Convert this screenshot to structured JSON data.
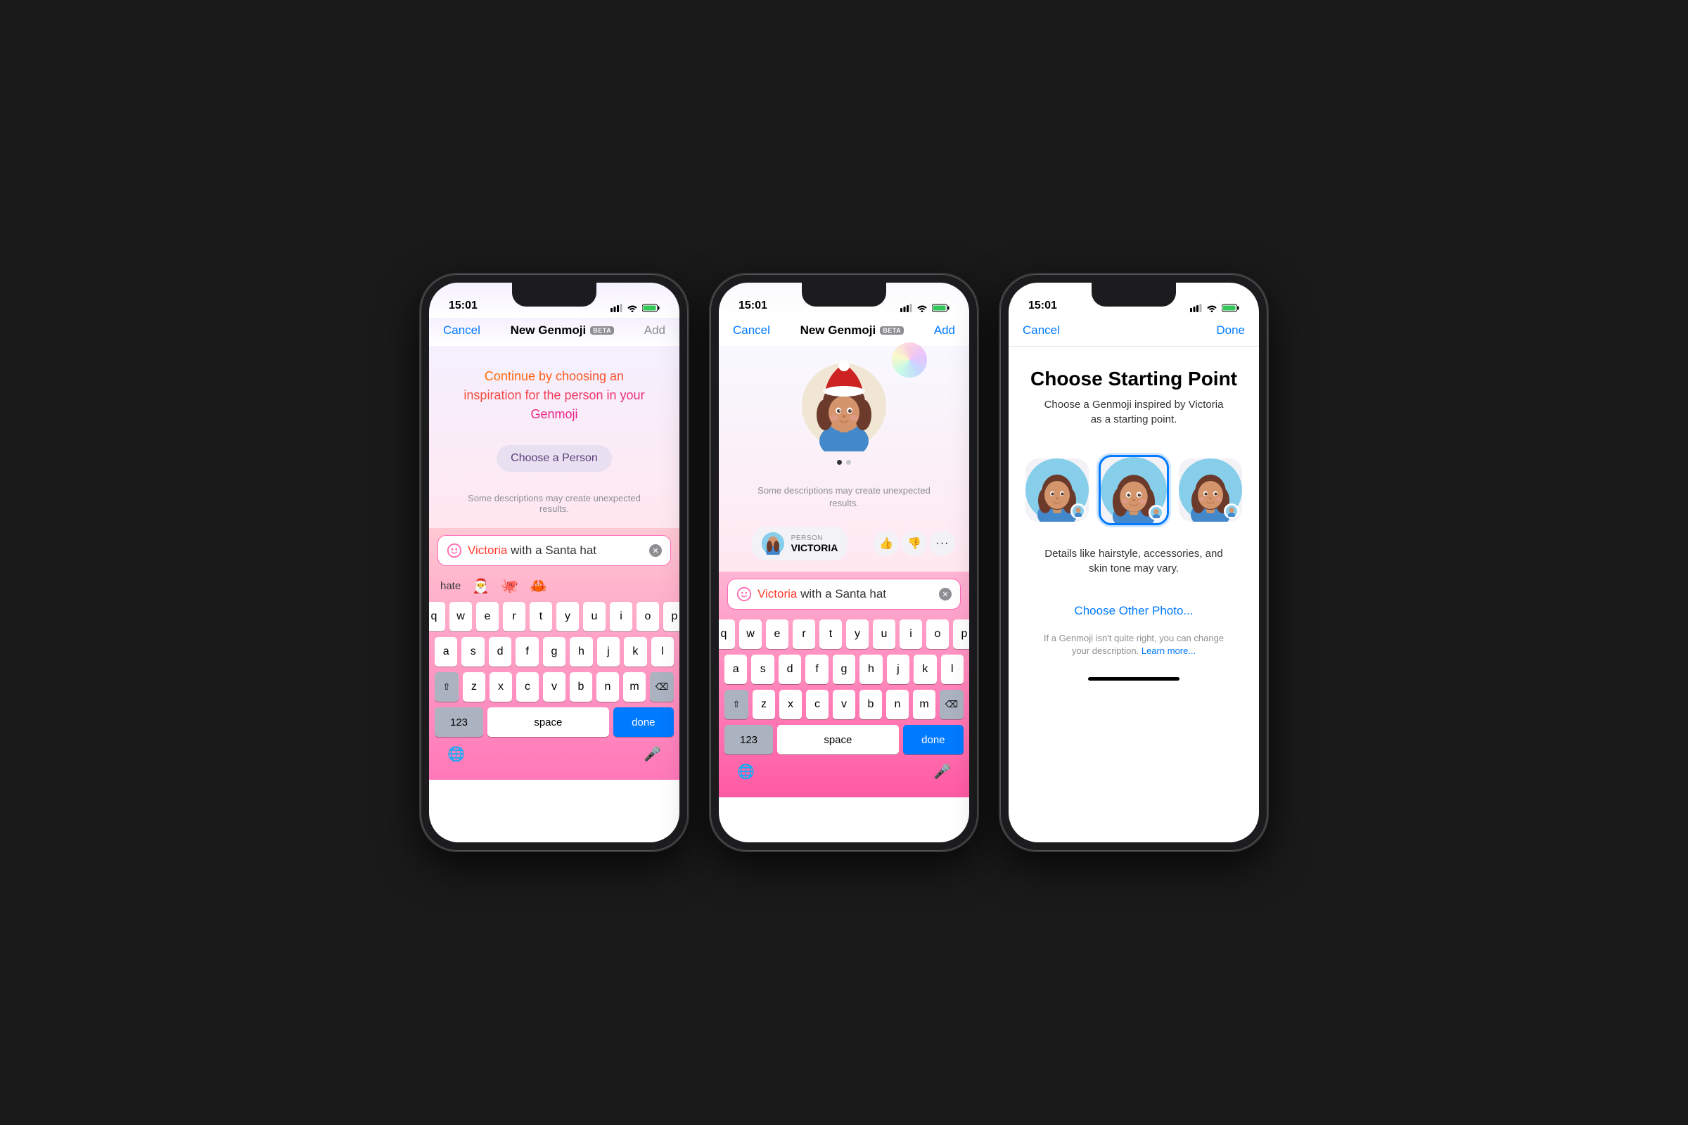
{
  "phone1": {
    "status_time": "15:01",
    "nav_cancel": "Cancel",
    "nav_title": "New Genmoji",
    "beta_label": "BETA",
    "nav_add": "Add",
    "inspiration_text_part1": "Continue by choosing an inspiration for the person in your Genmoji",
    "choose_person_btn": "Choose a Person",
    "unexpected_results": "Some descriptions may create unexpected results.",
    "input_text_highlight": "Victoria",
    "input_text_rest": " with a Santa hat",
    "autocomplete_word": "hate",
    "keyboard_rows": [
      [
        "q",
        "w",
        "e",
        "r",
        "t",
        "y",
        "u",
        "i",
        "o",
        "p"
      ],
      [
        "a",
        "s",
        "d",
        "f",
        "g",
        "h",
        "j",
        "k",
        "l"
      ],
      [
        "⇧",
        "z",
        "x",
        "c",
        "v",
        "b",
        "n",
        "m",
        "⌫"
      ],
      [
        "123",
        "space",
        "done"
      ]
    ],
    "bottom_icons": [
      "🌐",
      "🎤"
    ]
  },
  "phone2": {
    "status_time": "15:01",
    "nav_cancel": "Cancel",
    "nav_title": "New Genmoji",
    "beta_label": "BETA",
    "nav_add": "Add",
    "unexpected_results": "Some descriptions may create unexpected results.",
    "person_label": "PERSON",
    "person_name": "VICTORIA",
    "input_text_highlight": "Victoria",
    "input_text_rest": " with a Santa hat",
    "keyboard_rows": [
      [
        "q",
        "w",
        "e",
        "r",
        "t",
        "y",
        "u",
        "i",
        "o",
        "p"
      ],
      [
        "a",
        "s",
        "d",
        "f",
        "g",
        "h",
        "j",
        "k",
        "l"
      ],
      [
        "⇧",
        "z",
        "x",
        "c",
        "v",
        "b",
        "n",
        "m",
        "⌫"
      ],
      [
        "123",
        "space",
        "done"
      ]
    ],
    "bottom_icons": [
      "🌐",
      "🎤"
    ]
  },
  "phone3": {
    "status_time": "15:01",
    "nav_cancel": "Cancel",
    "nav_done": "Done",
    "title": "Choose Starting Point",
    "subtitle": "Choose a Genmoji inspired by Victoria as a starting point.",
    "vary_text": "Details like hairstyle, accessories, and skin tone may vary.",
    "choose_other_photo": "Choose Other Photo...",
    "bottom_text": "If a Genmoji isn't quite right, you can change your description.",
    "learn_more": "Learn more...",
    "avatar_options": [
      {
        "id": "opt1",
        "selected": false
      },
      {
        "id": "opt2",
        "selected": true
      },
      {
        "id": "opt3",
        "selected": false
      }
    ]
  }
}
